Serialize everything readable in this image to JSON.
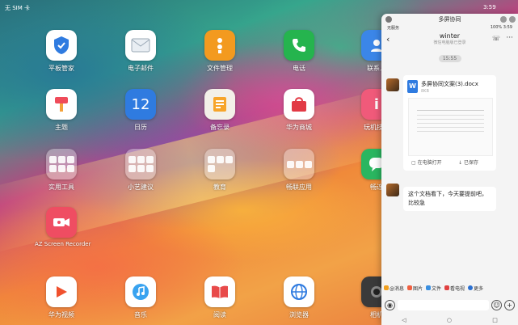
{
  "status_bar": {
    "left": "无 SIM 卡",
    "right": "3:59"
  },
  "apps": {
    "row1": [
      "平板管家",
      "电子邮件",
      "文件管理",
      "电话",
      "联系人"
    ],
    "row2": [
      "主题",
      "日历",
      "备忘录",
      "华为商城",
      "玩机技巧"
    ],
    "row3": [
      "实用工具",
      "小艺建议",
      "教育",
      "畅联应用",
      "畅连"
    ],
    "row4": [
      "AZ Screen Recorder"
    ],
    "dock": [
      "华为视频",
      "音乐",
      "阅读",
      "浏览器",
      "相机"
    ],
    "calendar_day": "12"
  },
  "panel": {
    "title": "多屏协同",
    "status_left": "无服务",
    "status_right": "100% 3:59",
    "chat_name": "winter",
    "chat_sub": "微信电脑版已登录",
    "time_chip": "15:55",
    "file_name": "多屏协同文案(3).docx",
    "file_size": "8KB",
    "file_open": "在电脑打开",
    "file_save": "已保存",
    "message": "这个文档看下，今天要提前吧，比较急",
    "quick_actions": [
      {
        "label": "@消息",
        "color": "#f0a020"
      },
      {
        "label": "图片",
        "color": "#f06040"
      },
      {
        "label": "文件",
        "color": "#3a8fe0"
      },
      {
        "label": "看电视",
        "color": "#e04040"
      },
      {
        "label": "更多",
        "color": "#2a6fd0"
      }
    ],
    "nav": [
      "◁",
      "○",
      "□"
    ]
  }
}
